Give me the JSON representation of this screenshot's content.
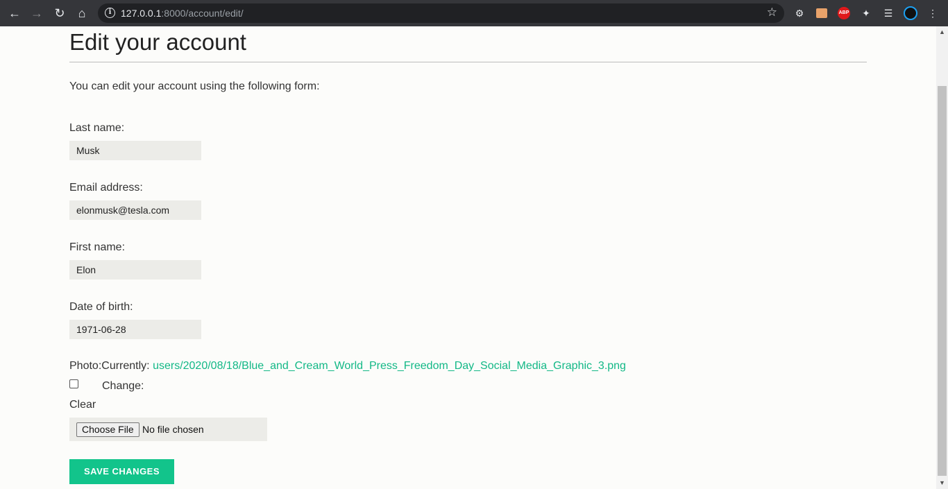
{
  "browser": {
    "url_host": "127.0.0.1",
    "url_path": ":8000/account/edit/"
  },
  "page": {
    "title": "Edit your account",
    "intro": "You can edit your account using the following form:"
  },
  "form": {
    "last_name_label": "Last name:",
    "last_name_value": "Musk",
    "email_label": "Email address:",
    "email_value": "elonmusk@tesla.com",
    "first_name_label": "First name:",
    "first_name_value": "Elon",
    "dob_label": "Date of birth:",
    "dob_value": "1971-06-28",
    "photo_label": "Photo:",
    "currently_label": "Currently: ",
    "photo_link": "users/2020/08/18/Blue_and_Cream_World_Press_Freedom_Day_Social_Media_Graphic_3.png",
    "change_label": "Change:",
    "clear_label": "Clear",
    "choose_file_label": "Choose File",
    "file_status": "No file chosen",
    "save_label": "SAVE CHANGES"
  },
  "colors": {
    "accent": "#12c48b",
    "link": "#12b886",
    "chrome": "#35363a"
  }
}
